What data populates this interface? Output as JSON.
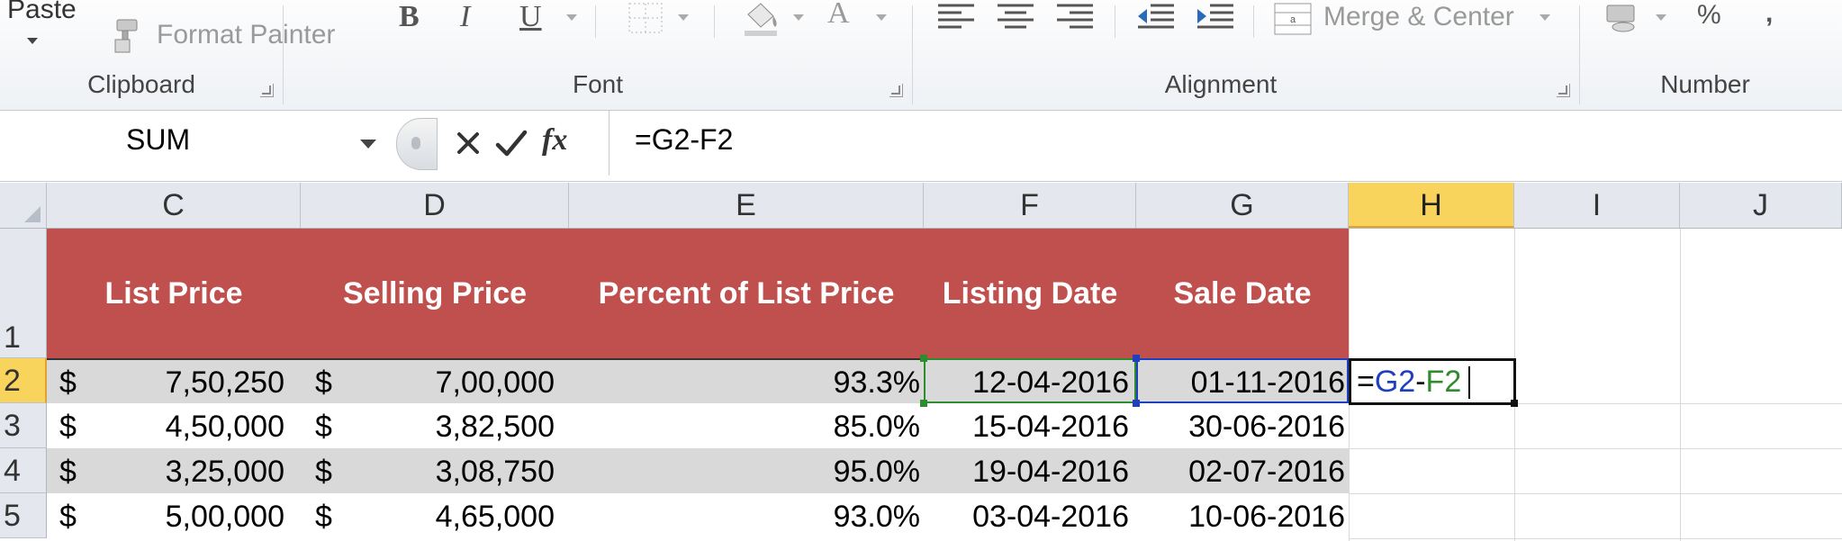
{
  "ribbon": {
    "clipboard": {
      "paste_label": "Paste",
      "format_painter_label": "Format Painter",
      "group_label": "Clipboard"
    },
    "font": {
      "bold": "B",
      "italic": "I",
      "underline": "U",
      "font_color_glyph": "A",
      "group_label": "Font"
    },
    "alignment": {
      "merge_center_label": "Merge & Center",
      "group_label": "Alignment"
    },
    "number": {
      "percent": "%",
      "comma": ",",
      "group_label": "Number"
    }
  },
  "formula_bar": {
    "name_box": "SUM",
    "fx_label": "fx",
    "formula": "=G2-F2"
  },
  "grid": {
    "columns": [
      "C",
      "D",
      "E",
      "F",
      "G",
      "H",
      "I",
      "J"
    ],
    "active_column": "H",
    "rows": [
      "1",
      "2",
      "3",
      "4",
      "5"
    ],
    "active_row": "2",
    "headers": [
      "List Price",
      "Selling Price",
      "Percent of List Price",
      "Listing Date",
      "Sale Date"
    ],
    "data": [
      {
        "currency_c": "$",
        "list_price": "7,50,250",
        "currency_d": "$",
        "selling_price": "7,00,000",
        "percent": "93.3%",
        "listing_date": "12-04-2016",
        "sale_date": "01-11-2016"
      },
      {
        "currency_c": "$",
        "list_price": "4,50,000",
        "currency_d": "$",
        "selling_price": "3,82,500",
        "percent": "85.0%",
        "listing_date": "15-04-2016",
        "sale_date": "30-06-2016"
      },
      {
        "currency_c": "$",
        "list_price": "3,25,000",
        "currency_d": "$",
        "selling_price": "3,08,750",
        "percent": "95.0%",
        "listing_date": "19-04-2016",
        "sale_date": "02-07-2016"
      },
      {
        "currency_c": "$",
        "list_price": "5,00,000",
        "currency_d": "$",
        "selling_price": "4,65,000",
        "percent": "93.0%",
        "listing_date": "03-04-2016",
        "sale_date": "10-06-2016"
      }
    ],
    "edit_cell": {
      "eq": "=",
      "ref1": "G2",
      "minus": "-",
      "ref2": "F2",
      "ref1_color": "#1f3fbf",
      "ref2_color": "#2e8b2e"
    },
    "header_fill": "#c0504d",
    "band_fill": "#d9d9d9"
  }
}
